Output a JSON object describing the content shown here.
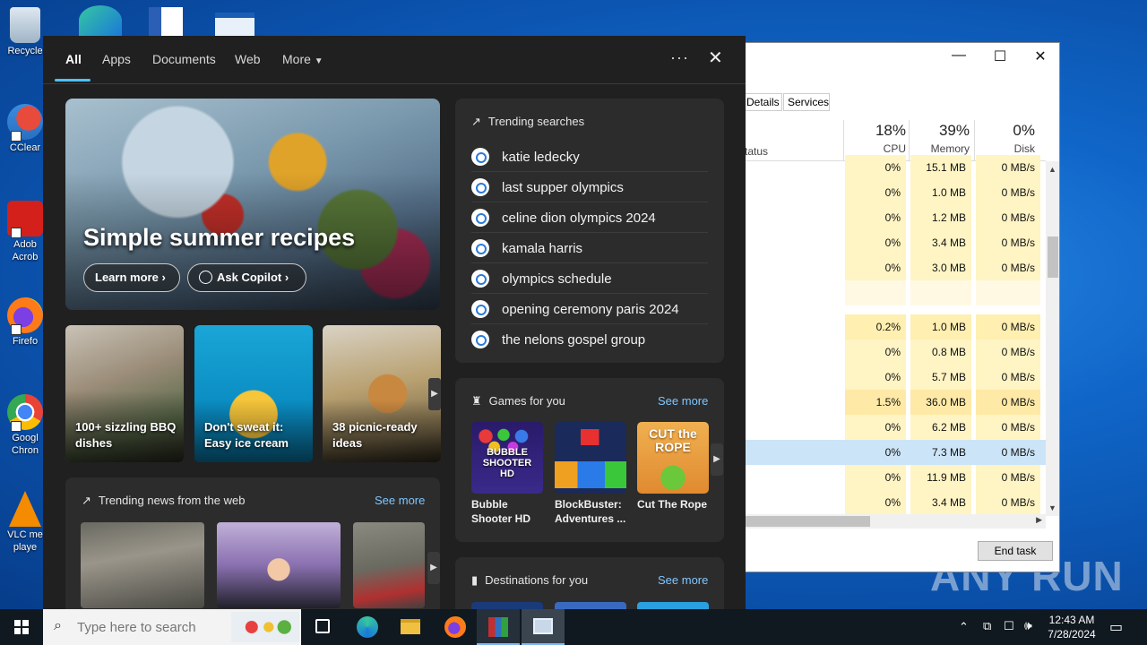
{
  "desktop": {
    "icons": [
      {
        "label": "Recycle",
        "name": "desktop-icon-recycle-bin"
      },
      {
        "label": "CClear",
        "name": "desktop-icon-ccleaner"
      },
      {
        "label": "Adob Acrob",
        "name": "desktop-icon-acrobat"
      },
      {
        "label": "Firefo",
        "name": "desktop-icon-firefox"
      },
      {
        "label": "Googl Chron",
        "name": "desktop-icon-chrome"
      },
      {
        "label": "VLC me playe",
        "name": "desktop-icon-vlc"
      }
    ],
    "watermark": "ANY RUN"
  },
  "taskmanager": {
    "tabs": [
      "Details",
      "Services"
    ],
    "col_status": "Status",
    "cols": [
      {
        "pct": "18%",
        "label": "CPU"
      },
      {
        "pct": "39%",
        "label": "Memory"
      },
      {
        "pct": "0%",
        "label": "Disk"
      }
    ],
    "rows": [
      {
        "cpu": "0%",
        "mem": "15.1 MB",
        "disk": "0 MB/s"
      },
      {
        "cpu": "0%",
        "mem": "1.0 MB",
        "disk": "0 MB/s"
      },
      {
        "cpu": "0%",
        "mem": "1.2 MB",
        "disk": "0 MB/s"
      },
      {
        "cpu": "0%",
        "mem": "3.4 MB",
        "disk": "0 MB/s"
      },
      {
        "cpu": "0%",
        "mem": "3.0 MB",
        "disk": "0 MB/s"
      },
      {
        "cpu": "",
        "mem": "",
        "disk": ""
      },
      {
        "cpu": "0.2%",
        "mem": "1.0 MB",
        "disk": "0 MB/s"
      },
      {
        "cpu": "0%",
        "mem": "0.8 MB",
        "disk": "0 MB/s"
      },
      {
        "cpu": "0%",
        "mem": "5.7 MB",
        "disk": "0 MB/s"
      },
      {
        "cpu": "1.5%",
        "mem": "36.0 MB",
        "disk": "0 MB/s"
      },
      {
        "cpu": "0%",
        "mem": "6.2 MB",
        "disk": "0 MB/s"
      },
      {
        "cpu": "0%",
        "mem": "7.3 MB",
        "disk": "0 MB/s"
      },
      {
        "cpu": "0%",
        "mem": "11.9 MB",
        "disk": "0 MB/s"
      },
      {
        "cpu": "0%",
        "mem": "3.4 MB",
        "disk": "0 MB/s"
      }
    ],
    "end_task": "End task"
  },
  "search": {
    "tabs": [
      "All",
      "Apps",
      "Documents",
      "Web",
      "More"
    ],
    "hero": {
      "title": "Simple summer recipes",
      "learn_more": "Learn more",
      "ask_copilot": "Ask Copilot"
    },
    "tiles": [
      "100+ sizzling BBQ dishes",
      "Don't sweat it: Easy ice cream",
      "38 picnic-ready ideas"
    ],
    "trending_news": {
      "title": "Trending news from the web",
      "see_more": "See more"
    },
    "trending_searches": {
      "title": "Trending searches",
      "items": [
        "katie ledecky",
        "last supper olympics",
        "celine dion olympics 2024",
        "kamala harris",
        "olympics schedule",
        "opening ceremony paris 2024",
        "the nelons gospel group"
      ]
    },
    "games": {
      "title": "Games for you",
      "see_more": "See more",
      "items": [
        {
          "name": "Bubble Shooter HD",
          "art": "BUBBLE SHOOTER HD"
        },
        {
          "name": "BlockBuster: Adventures ...",
          "art": ""
        },
        {
          "name": "Cut The Rope",
          "art": "CUT the ROPE"
        }
      ]
    },
    "destinations": {
      "title": "Destinations for you",
      "see_more": "See more"
    }
  },
  "taskbar": {
    "search_placeholder": "Type here to search",
    "time": "12:43 AM",
    "date": "7/28/2024"
  }
}
